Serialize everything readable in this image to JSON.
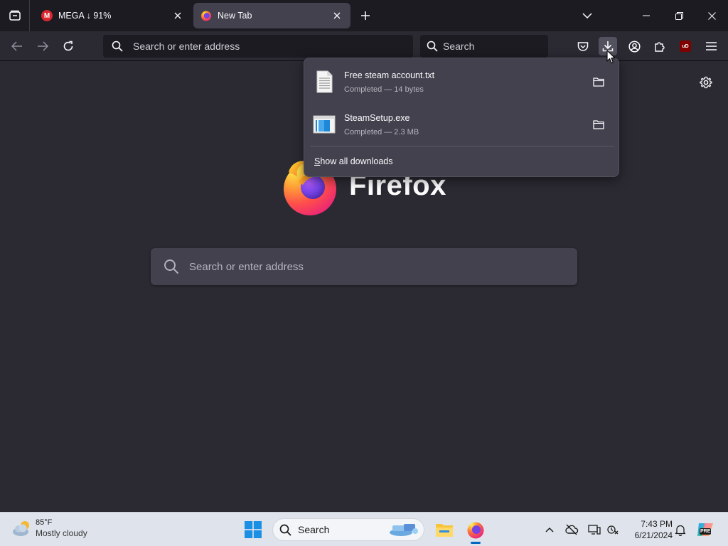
{
  "colors": {
    "chrome_dark": "#1c1b22",
    "toolbar": "#2b2a33",
    "active_tab": "#42414d",
    "panel": "#42414d",
    "mega_red": "#d9272e",
    "ublock_red": "#800000",
    "taskbar": "#dfe4ec",
    "taskbar_accent": "#0067c0"
  },
  "tabs": [
    {
      "title": "MEGA ↓ 91%",
      "favicon": "mega-icon",
      "favicon_letter": "M",
      "active": false
    },
    {
      "title": "New Tab",
      "favicon": "firefox-icon",
      "active": true
    }
  ],
  "toolbar": {
    "url_placeholder": "Search or enter address",
    "search_placeholder": "Search",
    "extension_badge": "uD"
  },
  "downloads_panel": {
    "items": [
      {
        "filename": "Free steam account.txt",
        "status": "Completed — 14 bytes",
        "icon": "text-file-icon"
      },
      {
        "filename": "SteamSetup.exe",
        "status": "Completed — 2.3 MB",
        "icon": "installer-file-icon"
      }
    ],
    "show_all_accesskey": "S",
    "show_all_rest": "how all downloads"
  },
  "new_tab_page": {
    "logo_wordmark": "Firefox",
    "search_placeholder": "Search or enter address"
  },
  "taskbar": {
    "weather": {
      "temperature": "85°F",
      "condition": "Mostly cloudy"
    },
    "search_label": "Search",
    "clock": {
      "time": "7:43 PM",
      "date": "6/21/2024"
    },
    "copilot_badge": "PRE"
  }
}
